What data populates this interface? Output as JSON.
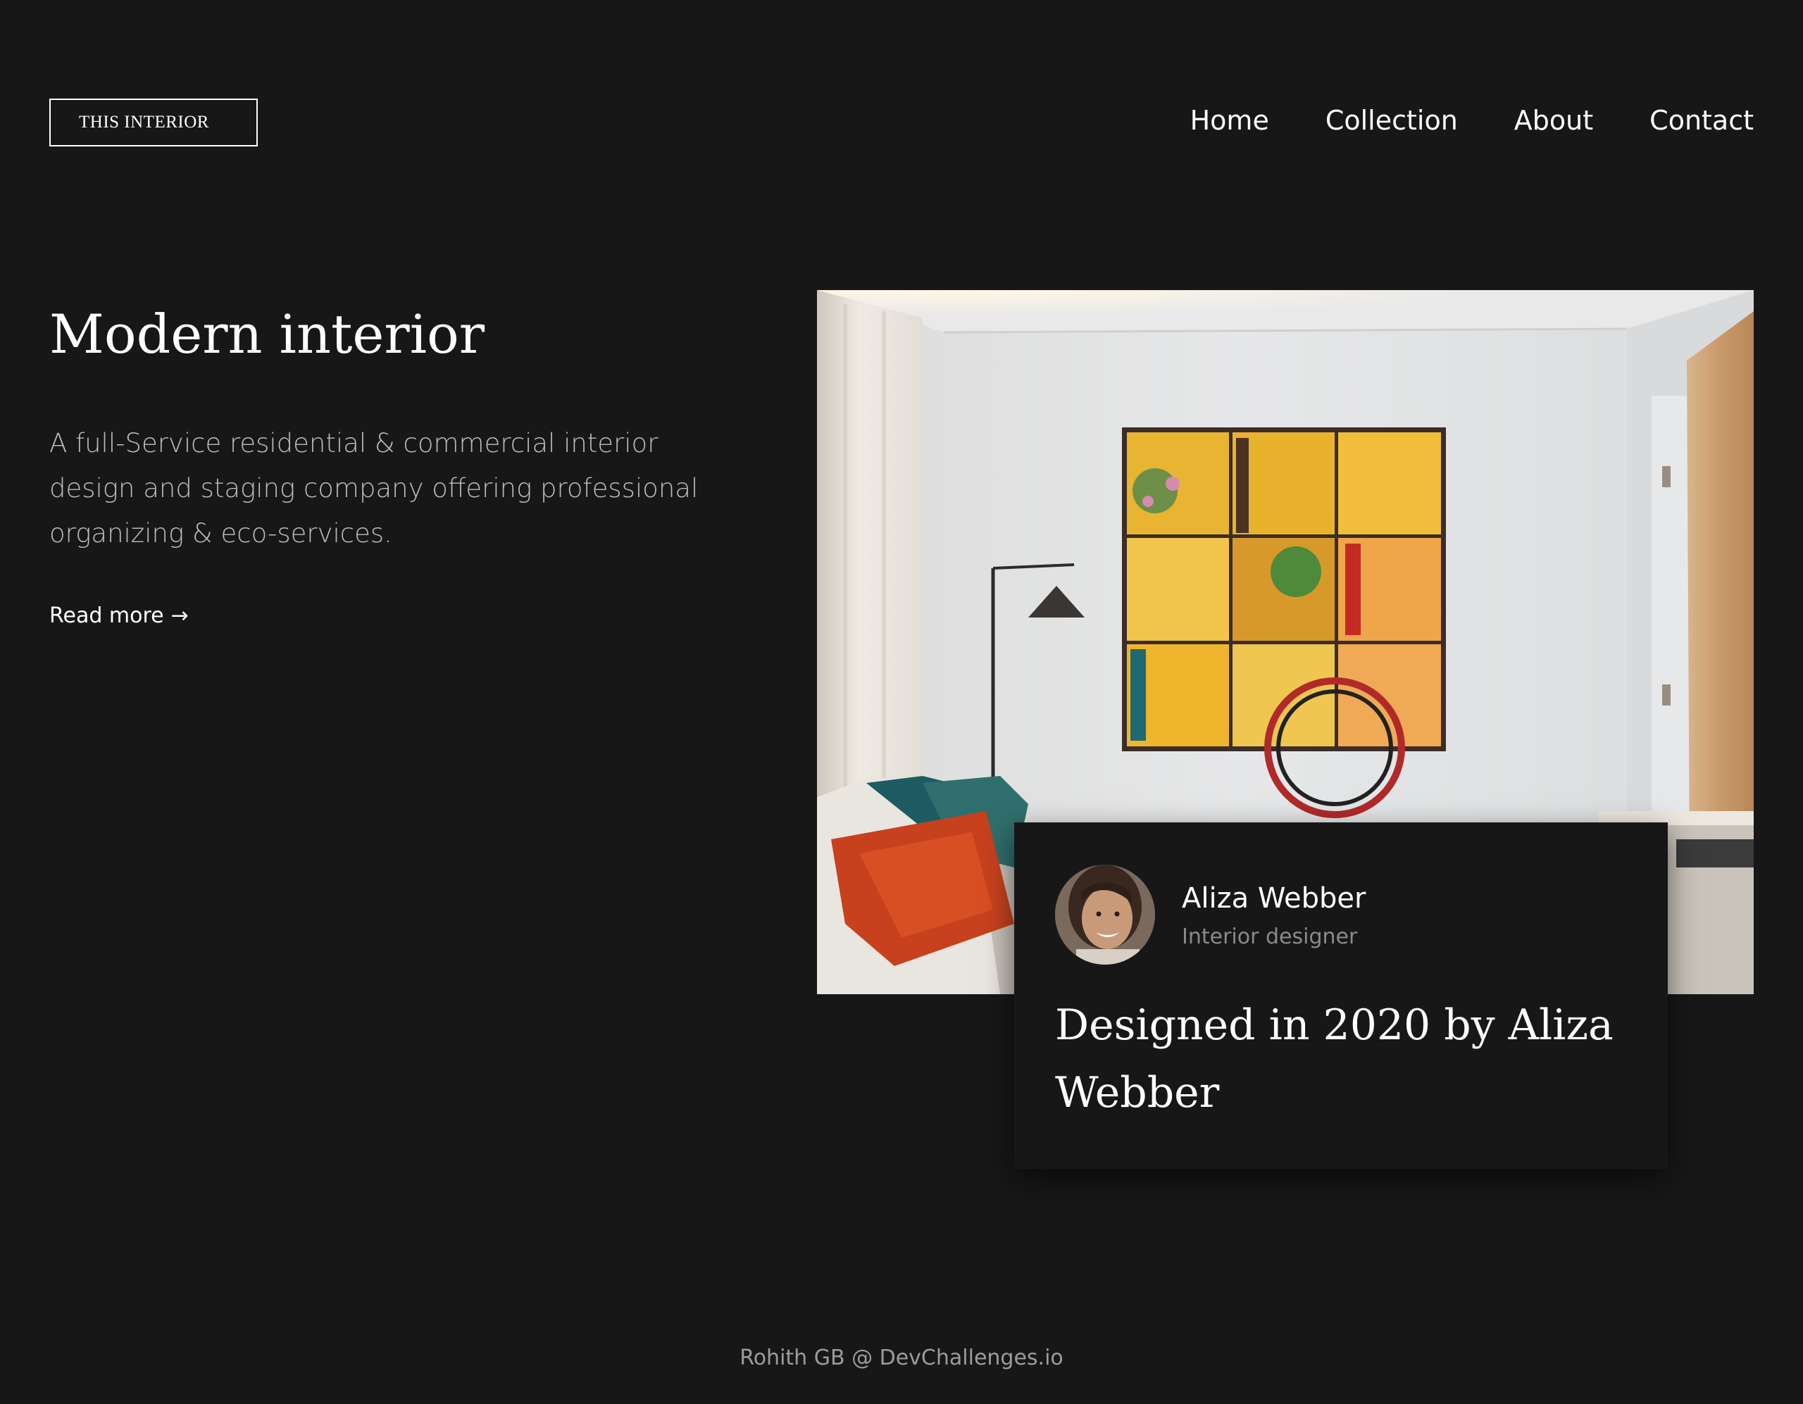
{
  "header": {
    "logo": "THIS INTERIOR",
    "nav": [
      {
        "label": "Home"
      },
      {
        "label": "Collection"
      },
      {
        "label": "About"
      },
      {
        "label": "Contact"
      }
    ]
  },
  "hero": {
    "title": "Modern interior",
    "description": "A full-Service residential & commercial interior design and staging company offering professional organizing & eco-services.",
    "read_more": "Read more",
    "read_more_arrow": "→"
  },
  "card": {
    "name": "Aliza Webber",
    "role": "Interior designer",
    "title": "Designed in 2020 by Aliza Webber"
  },
  "footer": {
    "credit": "Rohith GB @ DevChallenges.io"
  },
  "colors": {
    "background": "#171718",
    "text": "#ffffff",
    "muted": "#bdbdbd"
  }
}
